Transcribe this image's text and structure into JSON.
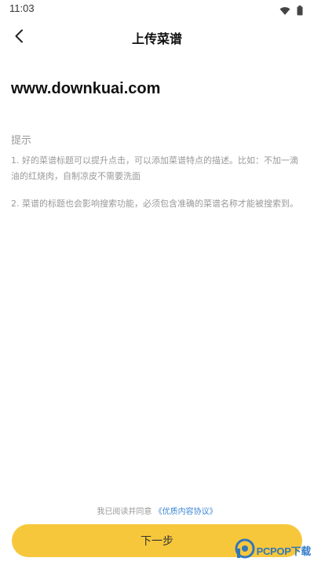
{
  "status_bar": {
    "time": "11:03",
    "icons": [
      "wifi-icon",
      "battery-icon"
    ]
  },
  "header": {
    "back_icon": "chevron-left-icon",
    "title": "上传菜谱"
  },
  "recipe": {
    "title_value": "www.downkuai.com"
  },
  "tips": {
    "heading": "提示",
    "items": [
      "1. 好的菜谱标题可以提升点击，可以添加菜谱特点的描述。比如：不加一滴油的红烧肉，自制凉皮不需要洗面",
      "2. 菜谱的标题也会影响搜索功能，必须包含准确的菜谱名称才能被搜索到。"
    ]
  },
  "agreement": {
    "prefix": "我已阅读并同意",
    "link_label": "《优质内容协议》"
  },
  "footer": {
    "next_label": "下一步"
  },
  "watermark": {
    "text": "PCPOP下载"
  },
  "colors": {
    "accent": "#f7c73b",
    "link": "#3d86d6",
    "hint_text": "#999999"
  }
}
